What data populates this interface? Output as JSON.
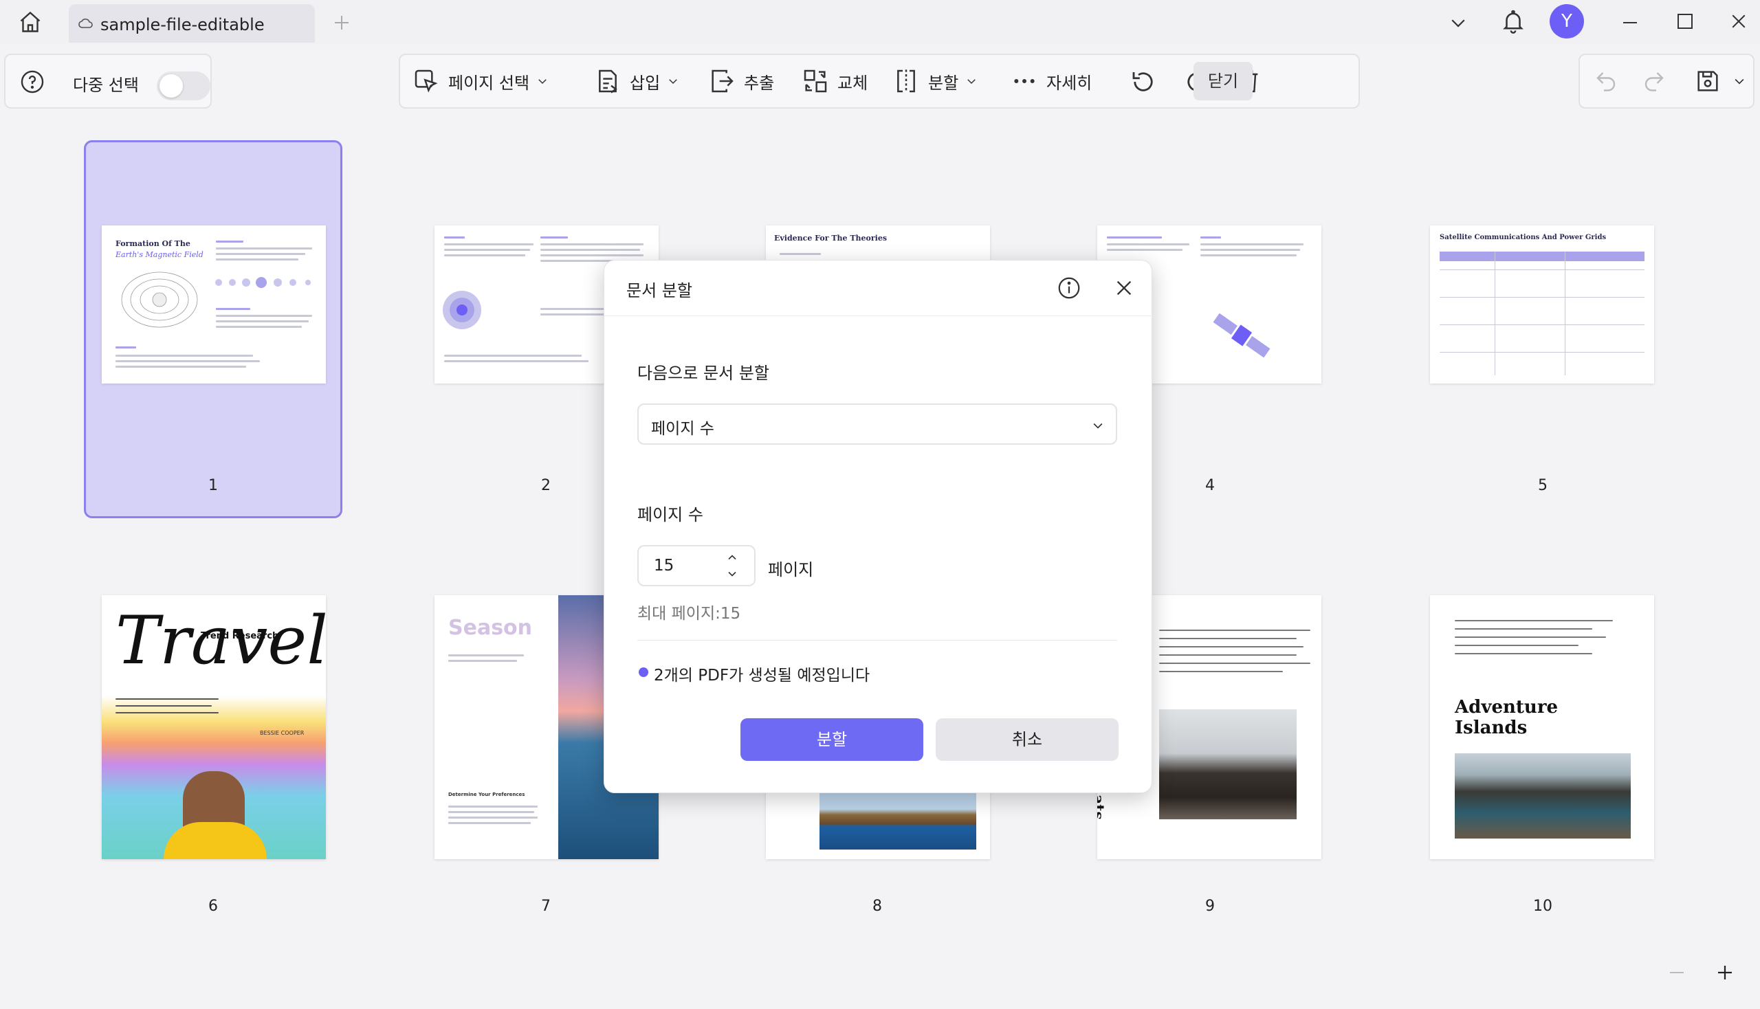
{
  "titlebar": {
    "tab_title": "sample-file-editable",
    "avatar_initial": "Y"
  },
  "toolbar": {
    "multi_select_label": "다중 선택",
    "page_select_label": "페이지 선택",
    "insert_label": "삽입",
    "extract_label": "추출",
    "replace_label": "교체",
    "split_label": "분할",
    "more_label": "자세히",
    "close_label": "닫기"
  },
  "pages": [
    {
      "number": "1",
      "title_line1": "Formation Of The",
      "title_line2": "Earth's Magnetic Field"
    },
    {
      "number": "2"
    },
    {
      "number": "3",
      "title": "Evidence For The Theories"
    },
    {
      "number": "4"
    },
    {
      "number": "5",
      "title": "Satellite Communications And Power Grids"
    },
    {
      "number": "6",
      "title": "Travel",
      "subtitle": "Trend Research",
      "author": "BESSIE COOPER"
    },
    {
      "number": "7",
      "title": "Season",
      "subtitle": "Determine Your Preferences"
    },
    {
      "number": "8"
    },
    {
      "number": "9",
      "side_text": "ats"
    },
    {
      "number": "10",
      "title_line1": "Adventure",
      "title_line2": "Islands"
    }
  ],
  "dialog": {
    "title": "문서 분할",
    "split_by_label": "다음으로 문서 분할",
    "split_by_value": "페이지 수",
    "pages_label": "페이지 수",
    "pages_value": "15",
    "pages_unit": "페이지",
    "max_pages": "최대 페이지:15",
    "result_note": "2개의 PDF가 생성될 예정입니다",
    "split_button": "분할",
    "cancel_button": "취소"
  },
  "colors": {
    "accent": "#6f6af3",
    "selection_bg": "#d6d2f7",
    "selection_border": "#8b80ee"
  }
}
